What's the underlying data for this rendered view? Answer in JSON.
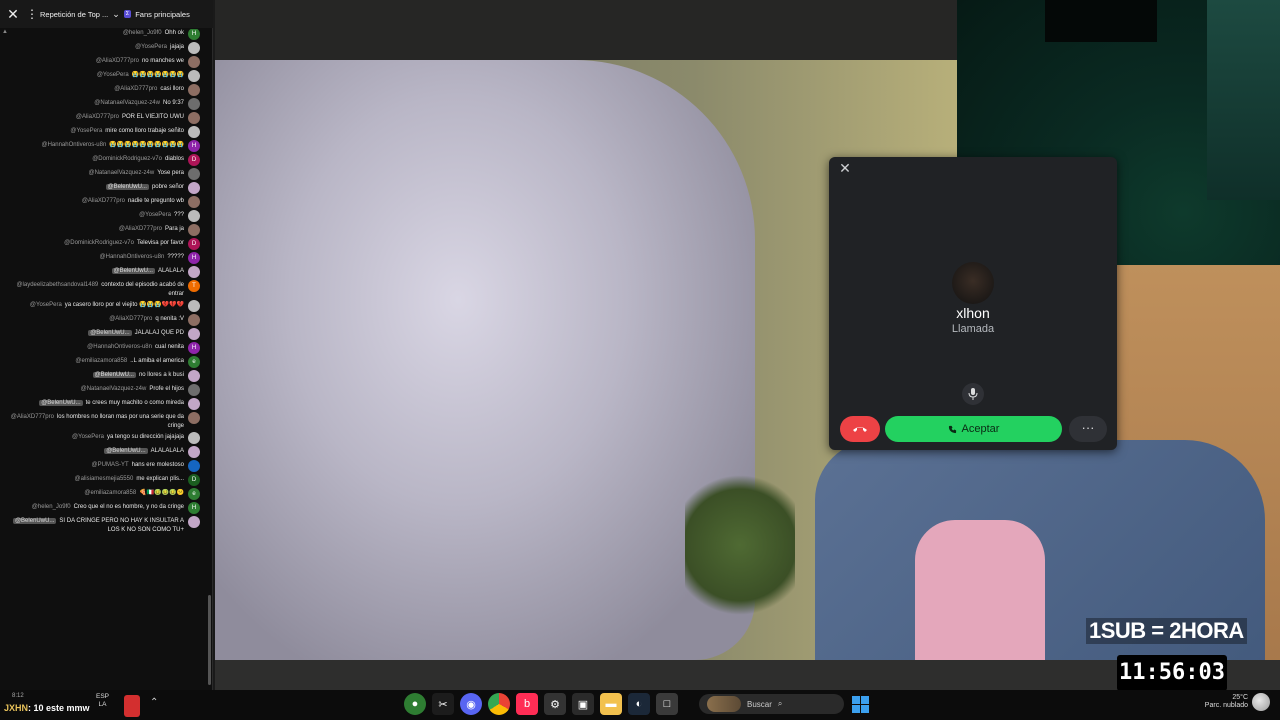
{
  "chat": {
    "title": "Repetición de Top ...",
    "title2": "Fans principales",
    "badge": "Σ",
    "messages": [
      {
        "author": "@helen_Jo9f0",
        "text": "Ohh ok",
        "avatar": "H",
        "color": "#2e7d32",
        "mod": false
      },
      {
        "author": "@YosePera",
        "text": "jajaja",
        "avatar": "",
        "color": "#bbbbbb",
        "mod": false
      },
      {
        "author": "@AliaXD777pro",
        "text": "no manches we",
        "avatar": "",
        "color": "#8d6e63",
        "mod": false
      },
      {
        "author": "@YosePera",
        "text": "😭😭😭😭😭😭😭",
        "avatar": "",
        "color": "#bbbbbb",
        "mod": false
      },
      {
        "author": "@AliaXD777pro",
        "text": "casi lloro",
        "avatar": "",
        "color": "#8d6e63",
        "mod": false
      },
      {
        "author": "@NatanaelVazquez-z4w",
        "text": "No 9:37",
        "avatar": "",
        "color": "#6d6d6d",
        "mod": false
      },
      {
        "author": "@AliaXD777pro",
        "text": "POR EL VIEJITO UWU",
        "avatar": "",
        "color": "#8d6e63",
        "mod": false
      },
      {
        "author": "@YosePera",
        "text": "mire como lloro trabaje señito",
        "avatar": "",
        "color": "#bbbbbb",
        "mod": false
      },
      {
        "author": "@HannahOntiveros-u8n",
        "text": "😭😭😭😭😭😭😭😭😭😭",
        "avatar": "H",
        "color": "#8e24aa",
        "mod": false
      },
      {
        "author": "@DominickRodriguez-v7o",
        "text": "diablos",
        "avatar": "D",
        "color": "#ad1457",
        "mod": false
      },
      {
        "author": "@NatanaelVazquez-z4w",
        "text": "Yose pera",
        "avatar": "",
        "color": "#6d6d6d",
        "mod": false
      },
      {
        "author": "@BelenUwU...",
        "text": "pobre señor",
        "avatar": "",
        "color": "#c2a6c7",
        "mod": true
      },
      {
        "author": "@AliaXD777pro",
        "text": "nadie te pregunto wb",
        "avatar": "",
        "color": "#8d6e63",
        "mod": false
      },
      {
        "author": "@YosePera",
        "text": "???",
        "avatar": "",
        "color": "#bbbbbb",
        "mod": false
      },
      {
        "author": "@AliaXD777pro",
        "text": "Para ja",
        "avatar": "",
        "color": "#8d6e63",
        "mod": false
      },
      {
        "author": "@DominickRodriguez-v7o",
        "text": "Televisa por favor",
        "avatar": "D",
        "color": "#ad1457",
        "mod": false
      },
      {
        "author": "@HannahOntiveros-u8n",
        "text": "?????",
        "avatar": "H",
        "color": "#8e24aa",
        "mod": false
      },
      {
        "author": "@BelenUwU...",
        "text": "ALALALA",
        "avatar": "",
        "color": "#c2a6c7",
        "mod": true
      },
      {
        "author": "@laydeelizabethsandoval1489",
        "text": "contexto del episodio acabó de entrar",
        "avatar": "T",
        "color": "#ef6c00",
        "mod": false
      },
      {
        "author": "@YosePera",
        "text": "ya casero lloro por el viejito 😭😭😭💔💔💔",
        "avatar": "",
        "color": "#bbbbbb",
        "mod": false
      },
      {
        "author": "@AliaXD777pro",
        "text": "q nenita :V",
        "avatar": "",
        "color": "#8d6e63",
        "mod": false
      },
      {
        "author": "@BelenUwU...",
        "text": "JALALAJ QUE PD",
        "avatar": "",
        "color": "#c2a6c7",
        "mod": true
      },
      {
        "author": "@HannahOntiveros-u8n",
        "text": "cual nenita",
        "avatar": "H",
        "color": "#8e24aa",
        "mod": false
      },
      {
        "author": "@emiliazamora858",
        "text": "..L amiba el america",
        "avatar": "e",
        "color": "#2e7d32",
        "mod": false
      },
      {
        "author": "@BelenUwU...",
        "text": "no llores a k busi",
        "avatar": "",
        "color": "#c2a6c7",
        "mod": true
      },
      {
        "author": "@NatanaelVazquez-z4w",
        "text": "Profe el hijos",
        "avatar": "",
        "color": "#6d6d6d",
        "mod": false
      },
      {
        "author": "@BelenUwU...",
        "text": "te crees muy machito o como mireda",
        "avatar": "",
        "color": "#c2a6c7",
        "mod": true
      },
      {
        "author": "@AliaXD777pro",
        "text": "los hombres no lloran mas por una serie que da cringe",
        "avatar": "",
        "color": "#8d6e63",
        "mod": false
      },
      {
        "author": "@YosePera",
        "text": "ya tengo su dirección jajajaja",
        "avatar": "",
        "color": "#bbbbbb",
        "mod": false
      },
      {
        "author": "@BelenUwU...",
        "text": "ALALALALA",
        "avatar": "",
        "color": "#c2a6c7",
        "mod": true
      },
      {
        "author": "@PUMAS-YT",
        "text": "hans ere molestoso",
        "avatar": "",
        "color": "#1565c0",
        "mod": false
      },
      {
        "author": "@alisiamesmejia5550",
        "text": "me explican plis...",
        "avatar": "D",
        "color": "#1b5e20",
        "mod": false
      },
      {
        "author": "@emiliazamora858",
        "text": "🍕🇮🇹🤢🤢🤢😕",
        "avatar": "e",
        "color": "#2e7d32",
        "mod": false
      },
      {
        "author": "@helen_Jo9f0",
        "text": "Creo que el no es hombre, y no da cringe",
        "avatar": "H",
        "color": "#2e7d32",
        "mod": false
      },
      {
        "author": "@BelenUwU...",
        "text": "SI DA CRINGE PERO NO HAY K INSULTAR A LOS K NO SON COMO TU+",
        "avatar": "",
        "color": "#c2a6c7",
        "mod": true
      }
    ]
  },
  "call": {
    "name": "xlhon",
    "status": "Llamada",
    "accept_label": "Aceptar"
  },
  "overlay": {
    "sub_text": "1SUB = 2HORA",
    "timer": "11:56:03"
  },
  "taskbar": {
    "game_prefix": "JXHN",
    "game_mid": ": 10 ",
    "game_suffix": "este mmw",
    "small_info": "8:12",
    "lang": "ESP",
    "lang2": "LA",
    "search_placeholder": "Buscar",
    "weather_temp": "25°C",
    "weather_desc": "Parc. nublado"
  }
}
